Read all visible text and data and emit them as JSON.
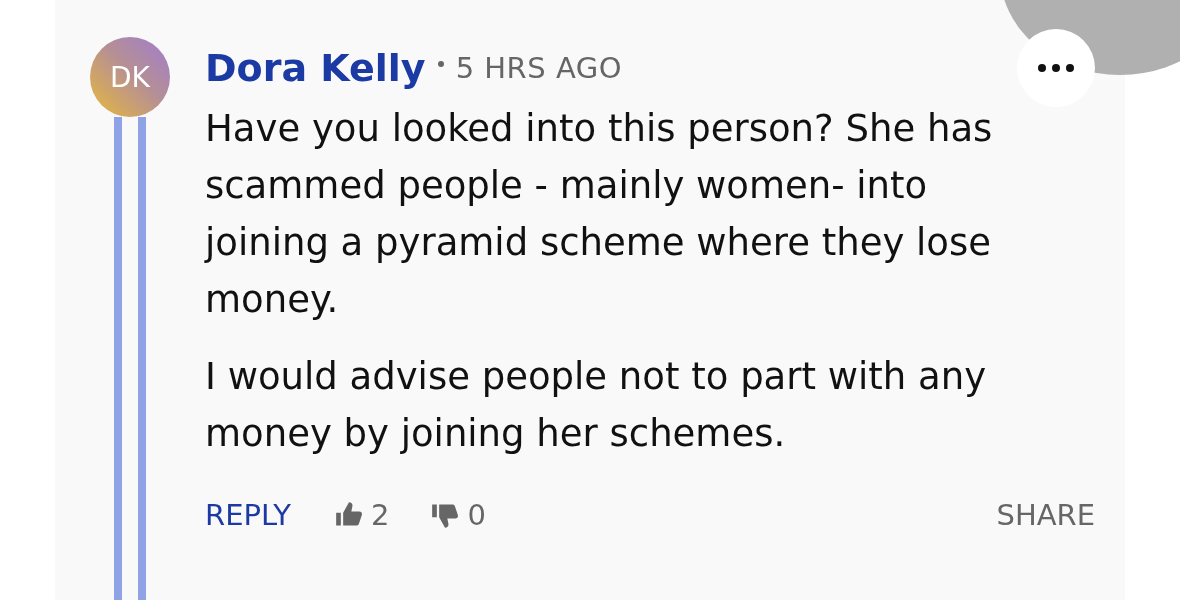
{
  "comment": {
    "author": "Dora Kelly",
    "initials": "DK",
    "time": "5 HRS AGO",
    "paragraphs": [
      "Have you looked into this person? She has scammed people - mainly women- into joining a pyramid scheme where they lose money.",
      "I would advise people not to part with any money by joining her schemes."
    ],
    "actions": {
      "reply": "REPLY",
      "likes": "2",
      "dislikes": "0",
      "share": "SHARE"
    }
  }
}
